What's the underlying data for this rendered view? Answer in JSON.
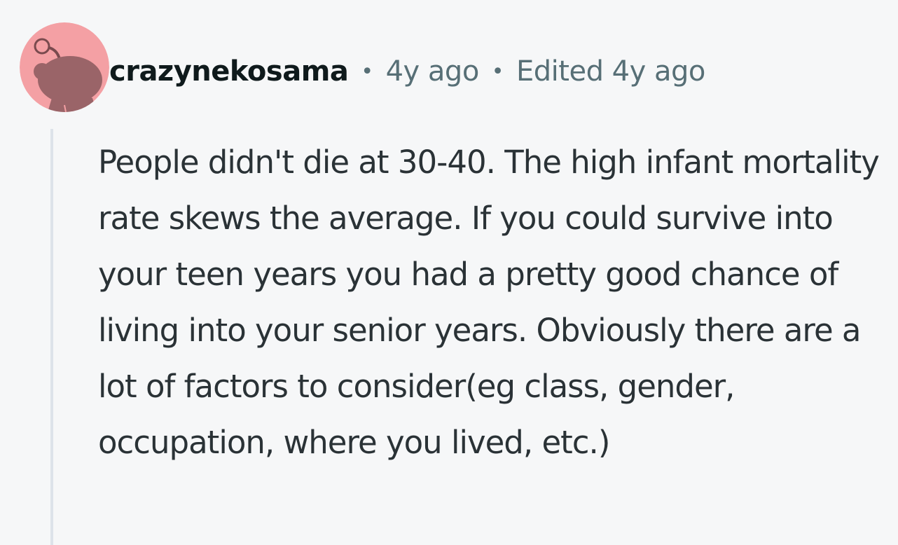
{
  "comment": {
    "author": "crazynekosama",
    "separator": "•",
    "posted": "4y ago",
    "edited": "Edited 4y ago",
    "avatar_icon": "reddit-snoo-avatar-icon",
    "avatar_color": "#f4a0a4",
    "body": "People didn't die at 30-40. The high infant mortality rate skews the average. If you could survive into your teen years you had a pretty good chance of living into your senior years. Obviously there are a lot of factors to consider(eg class, gender, occupation, where you lived, etc.)"
  }
}
